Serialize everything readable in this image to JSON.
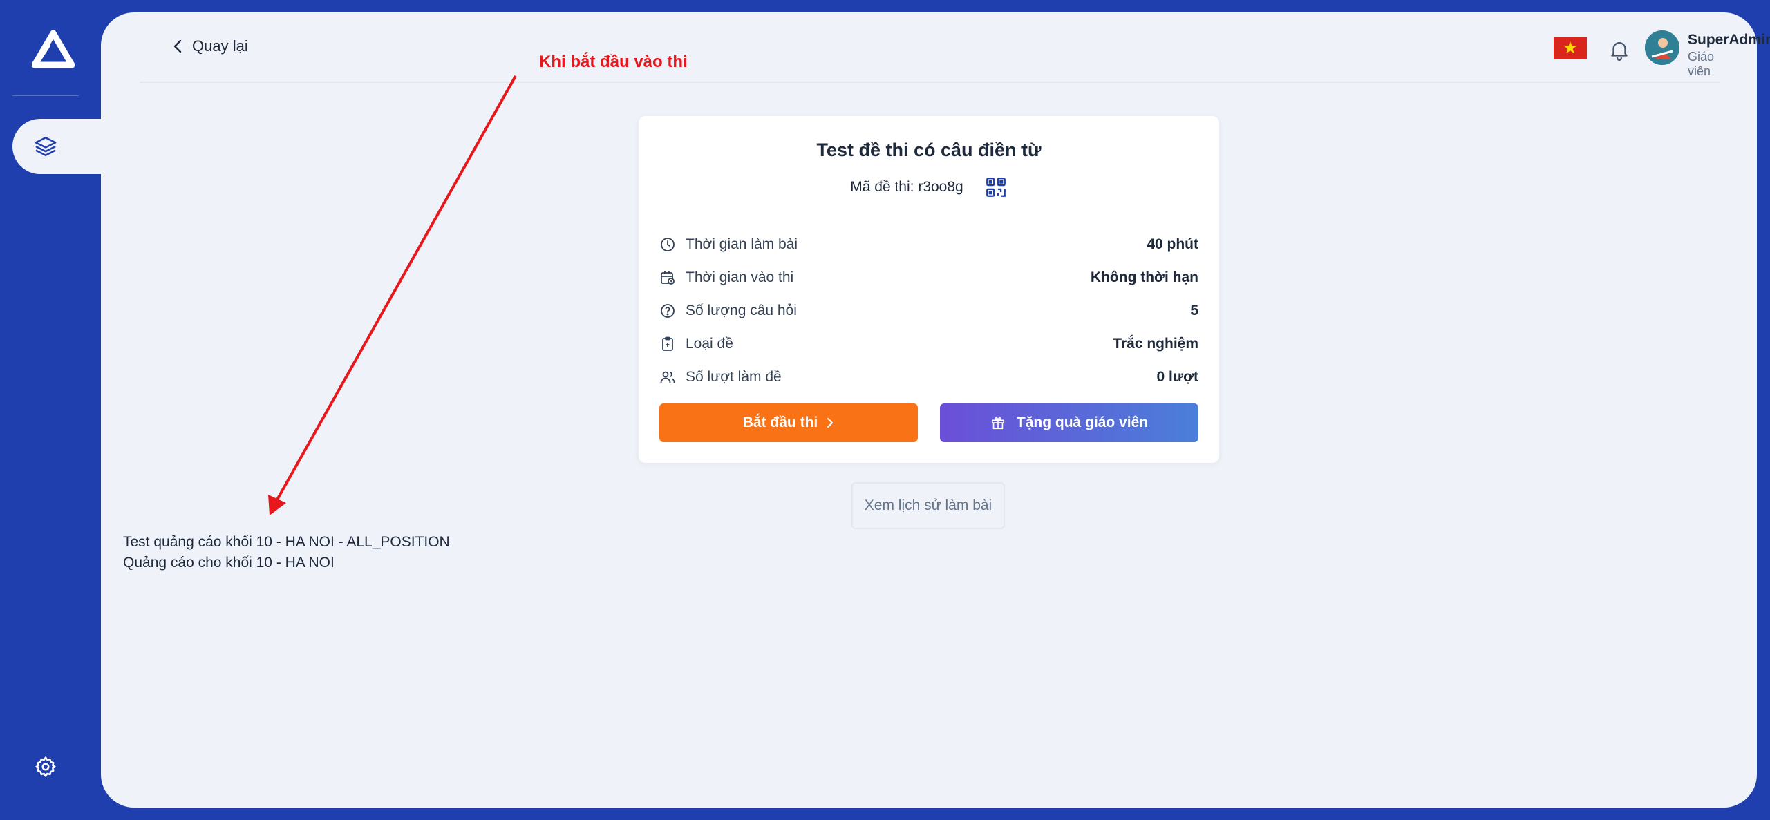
{
  "header": {
    "back_label": "Quay lại",
    "user_name": "SuperAdmin",
    "user_role": "Giáo viên",
    "language_flag": "vietnam-flag"
  },
  "annotation": {
    "text": "Khi bắt đầu vào thi",
    "color": "#e8171b"
  },
  "exam": {
    "title": "Test đề thi có câu điền từ",
    "code_label": "Mã đề thi:",
    "code_value": "r3oo8g",
    "details": [
      {
        "icon": "clock-icon",
        "label": "Thời gian làm bài",
        "value": "40 phút"
      },
      {
        "icon": "calendar-clock-icon",
        "label": "Thời gian vào thi",
        "value": "Không thời hạn"
      },
      {
        "icon": "question-circle-icon",
        "label": "Số lượng câu hỏi",
        "value": "5"
      },
      {
        "icon": "clipboard-icon",
        "label": "Loại đề",
        "value": "Trắc nghiệm"
      },
      {
        "icon": "users-icon",
        "label": "Số lượt làm đề",
        "value": "0 lượt"
      }
    ],
    "start_button": "Bắt đầu thi",
    "gift_button": "Tặng quà giáo viên",
    "history_button": "Xem lịch sử làm bài"
  },
  "ad": {
    "line1": "Test quảng cáo khối 10 - HA NOI - ALL_POSITION",
    "line2": "Quảng cáo cho khối 10 - HA NOI"
  },
  "colors": {
    "sidebar": "#1f3fae",
    "main_bg": "#eff3f9",
    "start_button": "#f97316",
    "gift_gradient_start": "#6b4fd8",
    "gift_gradient_end": "#4a7fd9"
  }
}
